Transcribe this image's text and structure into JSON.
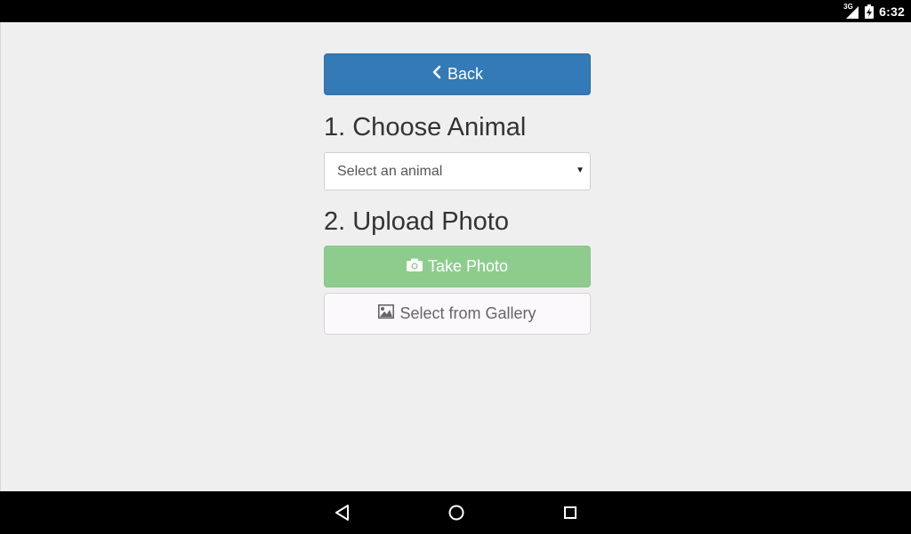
{
  "status_bar": {
    "network_type": "3G",
    "time": "6:32",
    "icons": [
      "signal-icon",
      "battery-charging-icon"
    ]
  },
  "main": {
    "back_button": {
      "label": "Back",
      "icon": "chevron-left-icon"
    },
    "step1_heading": "1. Choose Animal",
    "animal_select": {
      "selected": "Select an animal"
    },
    "step2_heading": "2. Upload Photo",
    "take_photo_button": {
      "label": "Take Photo",
      "icon": "camera-icon"
    },
    "gallery_button": {
      "label": "Select from Gallery",
      "icon": "picture-icon"
    }
  },
  "nav_bar": {
    "icons": [
      "back-triangle-icon",
      "home-circle-icon",
      "recents-square-icon"
    ]
  },
  "colors": {
    "primary": "#337ab7",
    "success": "#8ecc8e",
    "background": "#efefef",
    "heading_text": "#333333"
  }
}
